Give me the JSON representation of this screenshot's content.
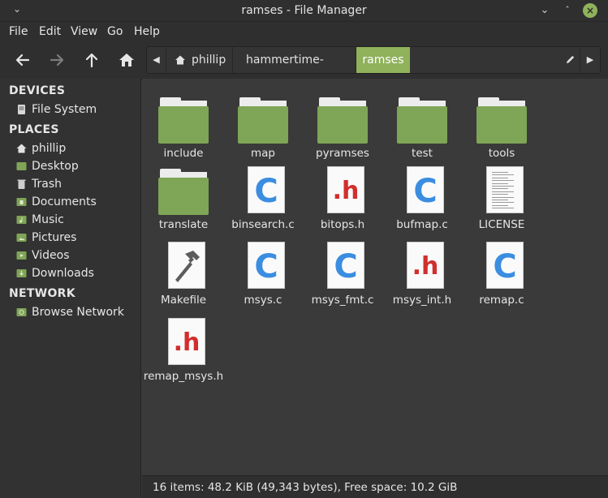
{
  "window": {
    "title": "ramses - File Manager",
    "accent": "#8fb25b"
  },
  "menu": [
    "File",
    "Edit",
    "View",
    "Go",
    "Help"
  ],
  "toolbar": {
    "icons": [
      "back-arrow-icon",
      "forward-arrow-icon",
      "up-arrow-icon",
      "home-icon"
    ]
  },
  "path": {
    "crumbs": [
      "phillip",
      "hammertime-master",
      "ramses"
    ],
    "active": "ramses"
  },
  "sidebar": {
    "sections": [
      {
        "title": "DEVICES",
        "items": [
          {
            "label": "File System",
            "icon": "drive-icon"
          }
        ]
      },
      {
        "title": "PLACES",
        "items": [
          {
            "label": "phillip",
            "icon": "home-icon"
          },
          {
            "label": "Desktop",
            "icon": "desktop-folder-icon"
          },
          {
            "label": "Trash",
            "icon": "trash-icon"
          },
          {
            "label": "Documents",
            "icon": "documents-folder-icon"
          },
          {
            "label": "Music",
            "icon": "music-folder-icon"
          },
          {
            "label": "Pictures",
            "icon": "pictures-folder-icon"
          },
          {
            "label": "Videos",
            "icon": "videos-folder-icon"
          },
          {
            "label": "Downloads",
            "icon": "downloads-folder-icon"
          }
        ]
      },
      {
        "title": "NETWORK",
        "items": [
          {
            "label": "Browse Network",
            "icon": "network-icon"
          }
        ]
      }
    ]
  },
  "files": [
    {
      "name": "include",
      "type": "folder"
    },
    {
      "name": "map",
      "type": "folder"
    },
    {
      "name": "pyramses",
      "type": "folder"
    },
    {
      "name": "test",
      "type": "folder"
    },
    {
      "name": "tools",
      "type": "folder"
    },
    {
      "name": "translate",
      "type": "folder"
    },
    {
      "name": "binsearch.c",
      "type": "c"
    },
    {
      "name": "bitops.h",
      "type": "h"
    },
    {
      "name": "bufmap.c",
      "type": "c"
    },
    {
      "name": "LICENSE",
      "type": "text"
    },
    {
      "name": "Makefile",
      "type": "makefile"
    },
    {
      "name": "msys.c",
      "type": "c"
    },
    {
      "name": "msys_fmt.c",
      "type": "c"
    },
    {
      "name": "msys_int.h",
      "type": "h"
    },
    {
      "name": "remap.c",
      "type": "c"
    },
    {
      "name": "remap_msys.h",
      "type": "h"
    }
  ],
  "status": "16 items: 48.2 KiB (49,343 bytes), Free space: 10.2 GiB"
}
